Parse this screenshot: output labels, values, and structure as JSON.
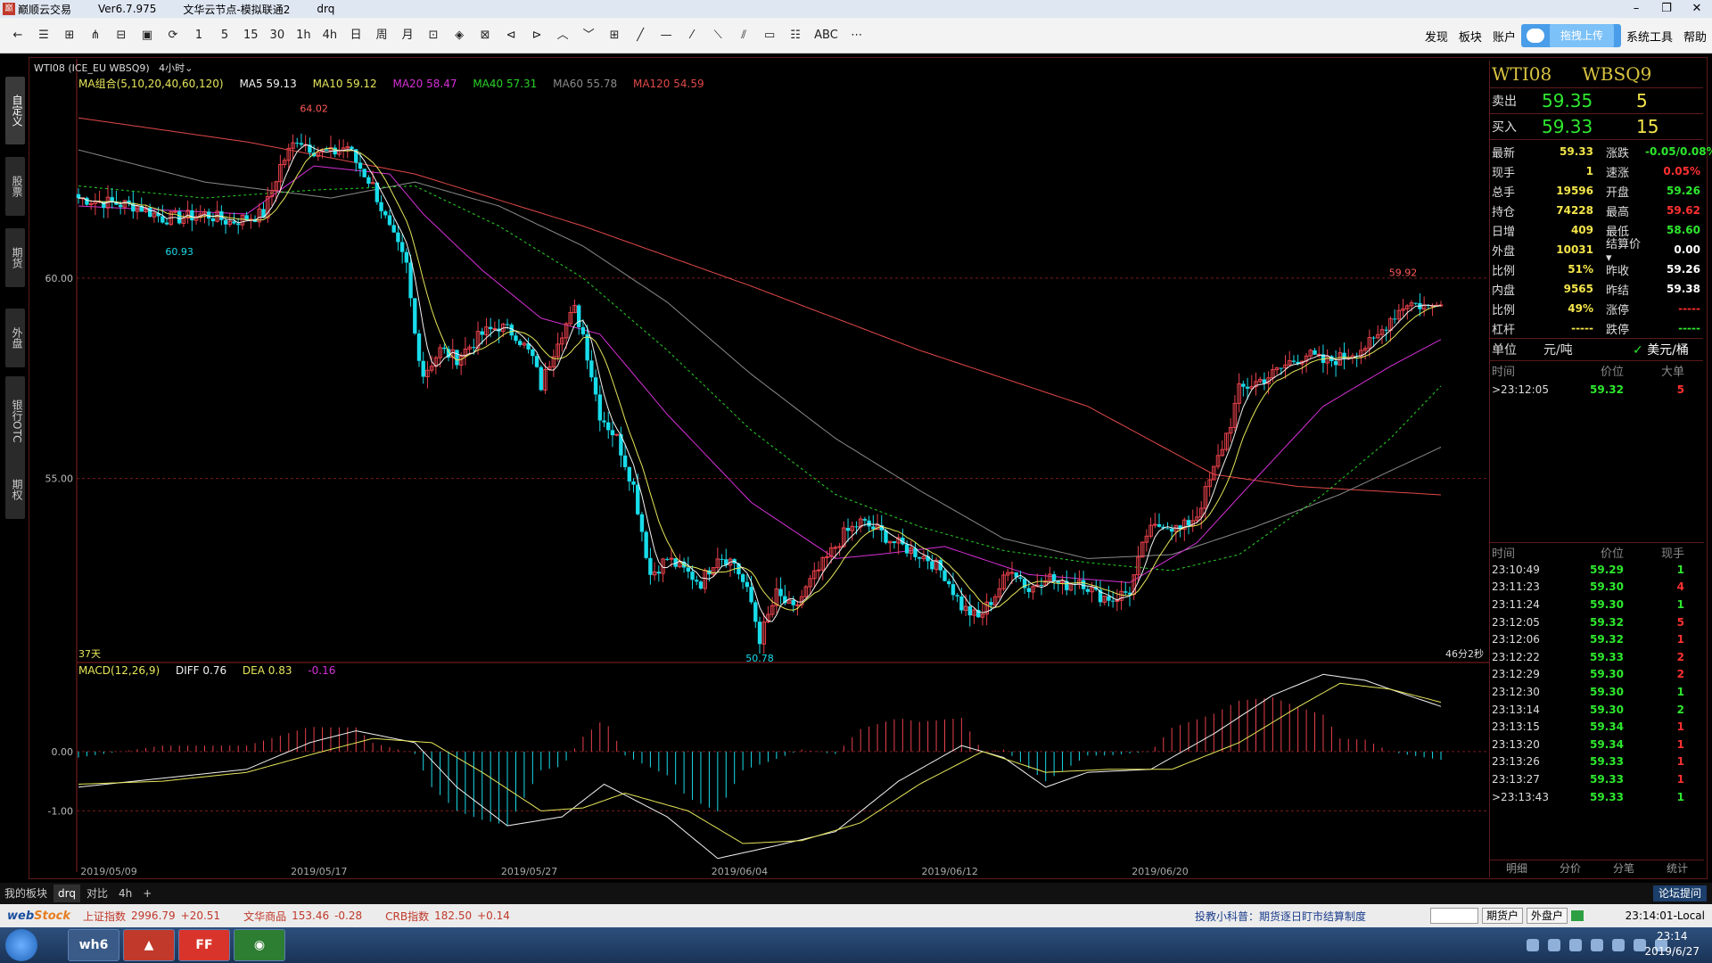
{
  "window": {
    "icon_text": "巅",
    "app_name": "巅顺云交易",
    "version": "Ver6.7.975",
    "node": "文华云节点-模拟联通2",
    "account": "drq",
    "min": "–",
    "restore": "❐",
    "close": "✕"
  },
  "toolbar": {
    "buttons": [
      "←",
      "☰",
      "⊞",
      "⋔",
      "⊟",
      "▣",
      "⟳",
      "1",
      "5",
      "15",
      "30",
      "1h",
      "4h",
      "日",
      "周",
      "月",
      "⊡",
      "◈",
      "⊠",
      "⊲",
      "⊳",
      "︿",
      "﹀",
      "⊞",
      "╱",
      "—",
      "⁄",
      "⟍",
      "⫽",
      "▭",
      "☷",
      "ABC",
      "⋯"
    ],
    "menu_discover": "发现",
    "menu_sector": "板块",
    "menu_account": "账户",
    "upload_label": "拖拽上传",
    "menu_tools": "系统工具",
    "menu_help": "帮助"
  },
  "left_tabs": [
    "自定义",
    "股票",
    "期货",
    "外盘",
    "银行OTC",
    "期权"
  ],
  "header": {
    "instrument": "WTI08  (ICE_EU WBSQ9)",
    "period": "4小时"
  },
  "ma_legend": {
    "group": "MA组合(5,10,20,40,60,120)",
    "ma5": "MA5 59.13",
    "ma10": "MA10 59.12",
    "ma20": "MA20 58.47",
    "ma40": "MA40 57.31",
    "ma60": "MA60 55.78",
    "ma120": "MA120 54.59"
  },
  "macd_legend": {
    "name": "MACD(12,26,9)",
    "diff": "DIFF 0.76",
    "dea": "DEA 0.83",
    "macd": "-0.16"
  },
  "colors": {
    "up": "#e8414b",
    "down": "#18dcea",
    "ma5": "#f2f2f2",
    "ma10": "#e6e65a",
    "ma20": "#d630d6",
    "ma40": "#28d228",
    "ma60": "#8a8a8a",
    "ma120": "#e04848",
    "diff": "#f2f2f2",
    "dea": "#e6e65a"
  },
  "chart_data": [
    {
      "type": "candlestick",
      "ylabel_ticks": [
        {
          "value": 60.0,
          "label": "60.00"
        },
        {
          "value": 55.0,
          "label": "55.00"
        }
      ],
      "ylim": [
        50.45,
        64.85
      ],
      "x_ticks": [
        "2019/05/09",
        "2019/05/17",
        "2019/05/27",
        "2019/06/04",
        "2019/06/12",
        "2019/06/20"
      ],
      "annotations": {
        "high": {
          "value": 64.02,
          "label": "64.02"
        },
        "low1": {
          "value": 60.93,
          "label": "60.93"
        },
        "low2": {
          "value": 50.78,
          "label": "50.78"
        },
        "recent_high": {
          "value": 59.92,
          "label": "59.92"
        },
        "days_label": "37天",
        "countdown": "46分2秒"
      },
      "anchors": [
        {
          "i": 0,
          "p": 62.0
        },
        {
          "i": 6,
          "p": 61.9
        },
        {
          "i": 14,
          "p": 61.8
        },
        {
          "i": 20,
          "p": 61.5
        },
        {
          "i": 24,
          "p": 61.5
        },
        {
          "i": 30,
          "p": 61.6
        },
        {
          "i": 36,
          "p": 61.4
        },
        {
          "i": 40,
          "p": 61.5
        },
        {
          "i": 44,
          "p": 61.6
        },
        {
          "i": 48,
          "p": 62.8
        },
        {
          "i": 52,
          "p": 63.5
        },
        {
          "i": 56,
          "p": 63.2
        },
        {
          "i": 60,
          "p": 63.1
        },
        {
          "i": 64,
          "p": 63.3
        },
        {
          "i": 66,
          "p": 62.9
        },
        {
          "i": 70,
          "p": 62.3
        },
        {
          "i": 74,
          "p": 61.2
        },
        {
          "i": 78,
          "p": 60.3
        },
        {
          "i": 80,
          "p": 58.6
        },
        {
          "i": 82,
          "p": 57.6
        },
        {
          "i": 86,
          "p": 58.2
        },
        {
          "i": 90,
          "p": 58.0
        },
        {
          "i": 96,
          "p": 58.6
        },
        {
          "i": 100,
          "p": 58.8
        },
        {
          "i": 104,
          "p": 58.6
        },
        {
          "i": 108,
          "p": 58.0
        },
        {
          "i": 110,
          "p": 57.3
        },
        {
          "i": 114,
          "p": 58.5
        },
        {
          "i": 118,
          "p": 59.2
        },
        {
          "i": 120,
          "p": 58.6
        },
        {
          "i": 124,
          "p": 56.6
        },
        {
          "i": 128,
          "p": 56.0
        },
        {
          "i": 132,
          "p": 54.8
        },
        {
          "i": 136,
          "p": 52.6
        },
        {
          "i": 140,
          "p": 53.0
        },
        {
          "i": 144,
          "p": 52.7
        },
        {
          "i": 148,
          "p": 52.4
        },
        {
          "i": 152,
          "p": 53.1
        },
        {
          "i": 156,
          "p": 52.9
        },
        {
          "i": 160,
          "p": 51.9
        },
        {
          "i": 162,
          "p": 51.0
        },
        {
          "i": 166,
          "p": 52.1
        },
        {
          "i": 170,
          "p": 51.7
        },
        {
          "i": 174,
          "p": 52.4
        },
        {
          "i": 178,
          "p": 53.0
        },
        {
          "i": 182,
          "p": 53.6
        },
        {
          "i": 186,
          "p": 53.9
        },
        {
          "i": 190,
          "p": 53.7
        },
        {
          "i": 194,
          "p": 53.4
        },
        {
          "i": 198,
          "p": 53.2
        },
        {
          "i": 202,
          "p": 53.0
        },
        {
          "i": 206,
          "p": 52.6
        },
        {
          "i": 210,
          "p": 51.8
        },
        {
          "i": 214,
          "p": 51.5
        },
        {
          "i": 218,
          "p": 52.1
        },
        {
          "i": 222,
          "p": 52.8
        },
        {
          "i": 226,
          "p": 52.2
        },
        {
          "i": 230,
          "p": 52.6
        },
        {
          "i": 234,
          "p": 52.3
        },
        {
          "i": 238,
          "p": 52.5
        },
        {
          "i": 242,
          "p": 52.1
        },
        {
          "i": 246,
          "p": 52.0
        },
        {
          "i": 250,
          "p": 52.2
        },
        {
          "i": 254,
          "p": 53.6
        },
        {
          "i": 258,
          "p": 53.9
        },
        {
          "i": 262,
          "p": 53.7
        },
        {
          "i": 266,
          "p": 54.1
        },
        {
          "i": 270,
          "p": 55.2
        },
        {
          "i": 274,
          "p": 56.4
        },
        {
          "i": 276,
          "p": 57.2
        },
        {
          "i": 280,
          "p": 57.4
        },
        {
          "i": 284,
          "p": 57.6
        },
        {
          "i": 288,
          "p": 57.9
        },
        {
          "i": 292,
          "p": 58.1
        },
        {
          "i": 296,
          "p": 57.9
        },
        {
          "i": 300,
          "p": 58.0
        },
        {
          "i": 304,
          "p": 58.2
        },
        {
          "i": 308,
          "p": 58.4
        },
        {
          "i": 312,
          "p": 59.0
        },
        {
          "i": 316,
          "p": 59.4
        },
        {
          "i": 320,
          "p": 59.3
        },
        {
          "i": 324,
          "p": 59.33
        }
      ],
      "ma_anchors": {
        "ma20": [
          {
            "i": 0,
            "p": 61.8
          },
          {
            "i": 40,
            "p": 61.6
          },
          {
            "i": 56,
            "p": 62.8
          },
          {
            "i": 74,
            "p": 62.6
          },
          {
            "i": 82,
            "p": 61.6
          },
          {
            "i": 96,
            "p": 60.2
          },
          {
            "i": 110,
            "p": 59.0
          },
          {
            "i": 124,
            "p": 58.6
          },
          {
            "i": 140,
            "p": 56.6
          },
          {
            "i": 160,
            "p": 54.4
          },
          {
            "i": 180,
            "p": 53.0
          },
          {
            "i": 190,
            "p": 53.1
          },
          {
            "i": 206,
            "p": 53.3
          },
          {
            "i": 226,
            "p": 52.6
          },
          {
            "i": 250,
            "p": 52.4
          },
          {
            "i": 266,
            "p": 53.4
          },
          {
            "i": 280,
            "p": 55.0
          },
          {
            "i": 296,
            "p": 56.8
          },
          {
            "i": 312,
            "p": 57.8
          },
          {
            "i": 324,
            "p": 58.47
          }
        ],
        "ma40": [
          {
            "i": 0,
            "p": 62.3
          },
          {
            "i": 30,
            "p": 62.0
          },
          {
            "i": 56,
            "p": 62.2
          },
          {
            "i": 80,
            "p": 62.3
          },
          {
            "i": 100,
            "p": 61.3
          },
          {
            "i": 120,
            "p": 60.0
          },
          {
            "i": 140,
            "p": 58.2
          },
          {
            "i": 160,
            "p": 56.2
          },
          {
            "i": 180,
            "p": 54.6
          },
          {
            "i": 200,
            "p": 53.8
          },
          {
            "i": 220,
            "p": 53.2
          },
          {
            "i": 240,
            "p": 52.9
          },
          {
            "i": 260,
            "p": 52.7
          },
          {
            "i": 276,
            "p": 53.1
          },
          {
            "i": 296,
            "p": 54.6
          },
          {
            "i": 312,
            "p": 56.0
          },
          {
            "i": 324,
            "p": 57.31
          }
        ],
        "ma60": [
          {
            "i": 0,
            "p": 63.2
          },
          {
            "i": 30,
            "p": 62.4
          },
          {
            "i": 60,
            "p": 62.0
          },
          {
            "i": 80,
            "p": 62.4
          },
          {
            "i": 100,
            "p": 61.8
          },
          {
            "i": 120,
            "p": 60.8
          },
          {
            "i": 140,
            "p": 59.4
          },
          {
            "i": 160,
            "p": 57.6
          },
          {
            "i": 180,
            "p": 56.0
          },
          {
            "i": 200,
            "p": 54.7
          },
          {
            "i": 220,
            "p": 53.5
          },
          {
            "i": 240,
            "p": 53.0
          },
          {
            "i": 260,
            "p": 53.1
          },
          {
            "i": 280,
            "p": 53.8
          },
          {
            "i": 300,
            "p": 54.6
          },
          {
            "i": 324,
            "p": 55.78
          }
        ],
        "ma120": [
          {
            "i": 0,
            "p": 64.0
          },
          {
            "i": 40,
            "p": 63.4
          },
          {
            "i": 80,
            "p": 62.6
          },
          {
            "i": 120,
            "p": 61.3
          },
          {
            "i": 160,
            "p": 59.8
          },
          {
            "i": 200,
            "p": 58.2
          },
          {
            "i": 240,
            "p": 56.8
          },
          {
            "i": 270,
            "p": 55.1
          },
          {
            "i": 290,
            "p": 54.8
          },
          {
            "i": 324,
            "p": 54.59
          }
        ]
      }
    },
    {
      "type": "macd",
      "ylabel_ticks": [
        {
          "value": 0.0,
          "label": "0.00"
        },
        {
          "value": -1.0,
          "label": "-1.00"
        }
      ],
      "ylim": [
        -1.88,
        1.47
      ],
      "diff_anchors": [
        {
          "i": 0,
          "v": -0.6
        },
        {
          "i": 20,
          "v": -0.45
        },
        {
          "i": 40,
          "v": -0.3
        },
        {
          "i": 55,
          "v": 0.15
        },
        {
          "i": 66,
          "v": 0.35
        },
        {
          "i": 80,
          "v": 0.15
        },
        {
          "i": 90,
          "v": -0.6
        },
        {
          "i": 102,
          "v": -1.25
        },
        {
          "i": 115,
          "v": -1.1
        },
        {
          "i": 125,
          "v": -0.55
        },
        {
          "i": 140,
          "v": -1.1
        },
        {
          "i": 152,
          "v": -1.8
        },
        {
          "i": 165,
          "v": -1.6
        },
        {
          "i": 180,
          "v": -1.35
        },
        {
          "i": 195,
          "v": -0.5
        },
        {
          "i": 210,
          "v": 0.1
        },
        {
          "i": 220,
          "v": -0.1
        },
        {
          "i": 230,
          "v": -0.6
        },
        {
          "i": 240,
          "v": -0.35
        },
        {
          "i": 255,
          "v": -0.3
        },
        {
          "i": 270,
          "v": 0.3
        },
        {
          "i": 284,
          "v": 0.95
        },
        {
          "i": 296,
          "v": 1.3
        },
        {
          "i": 306,
          "v": 1.2
        },
        {
          "i": 316,
          "v": 0.95
        },
        {
          "i": 324,
          "v": 0.76
        }
      ],
      "dea_anchors": [
        {
          "i": 0,
          "v": -0.55
        },
        {
          "i": 20,
          "v": -0.5
        },
        {
          "i": 40,
          "v": -0.35
        },
        {
          "i": 58,
          "v": 0.0
        },
        {
          "i": 70,
          "v": 0.22
        },
        {
          "i": 84,
          "v": 0.15
        },
        {
          "i": 96,
          "v": -0.35
        },
        {
          "i": 110,
          "v": -1.0
        },
        {
          "i": 120,
          "v": -0.95
        },
        {
          "i": 130,
          "v": -0.7
        },
        {
          "i": 145,
          "v": -1.0
        },
        {
          "i": 158,
          "v": -1.55
        },
        {
          "i": 172,
          "v": -1.5
        },
        {
          "i": 186,
          "v": -1.2
        },
        {
          "i": 200,
          "v": -0.55
        },
        {
          "i": 215,
          "v": 0.0
        },
        {
          "i": 230,
          "v": -0.35
        },
        {
          "i": 245,
          "v": -0.3
        },
        {
          "i": 260,
          "v": -0.3
        },
        {
          "i": 276,
          "v": 0.15
        },
        {
          "i": 290,
          "v": 0.75
        },
        {
          "i": 300,
          "v": 1.15
        },
        {
          "i": 312,
          "v": 1.05
        },
        {
          "i": 324,
          "v": 0.83
        }
      ]
    }
  ],
  "right_panel": {
    "symbol": "WTI08",
    "code": "WBSQ9",
    "ask_label": "卖出",
    "ask_price": "59.35",
    "ask_vol": "5",
    "bid_label": "买入",
    "bid_price": "59.33",
    "bid_vol": "15",
    "stats": [
      {
        "k1": "最新",
        "v1": "59.33",
        "c1": "#f4e54a",
        "k2": "涨跌",
        "v2": "-0.05/0.08%",
        "c2": "#2ee82e"
      },
      {
        "k1": "现手",
        "v1": "1",
        "c1": "#f4e54a",
        "k2": "速涨",
        "v2": "0.05%",
        "c2": "#ff3030"
      },
      {
        "k1": "总手",
        "v1": "19596",
        "c1": "#f4e54a",
        "k2": "开盘",
        "v2": "59.26",
        "c2": "#2ee82e"
      },
      {
        "k1": "持仓",
        "v1": "74228",
        "c1": "#f4e54a",
        "k2": "最高",
        "v2": "59.62",
        "c2": "#ff3030"
      },
      {
        "k1": "日增",
        "v1": "409",
        "c1": "#f4e54a",
        "k2": "最低",
        "v2": "58.60",
        "c2": "#2ee82e"
      },
      {
        "k1": "外盘",
        "v1": "10031",
        "c1": "#f4e54a",
        "k2": "结算价 ▾",
        "v2": "0.00",
        "c2": "#ffffff"
      },
      {
        "k1": "比例",
        "v1": "51%",
        "c1": "#f4e54a",
        "k2": "昨收",
        "v2": "59.26",
        "c2": "#ffffff"
      },
      {
        "k1": "内盘",
        "v1": "9565",
        "c1": "#f4e54a",
        "k2": "昨结",
        "v2": "59.38",
        "c2": "#ffffff"
      },
      {
        "k1": "比例",
        "v1": "49%",
        "c1": "#f4e54a",
        "k2": "涨停",
        "v2": "-----",
        "c2": "#ff3030"
      },
      {
        "k1": "杠杆",
        "v1": "-----",
        "c1": "#f4e54a",
        "k2": "跌停",
        "v2": "-----",
        "c2": "#2ee82e"
      }
    ],
    "unit_label": "单位",
    "unit_cny": "元/吨",
    "unit_check": "✓",
    "unit_usd": "美元/桶",
    "big_header": {
      "time": "时间",
      "price": "价位",
      "big": "大单"
    },
    "big_rows": [
      {
        "time": ">23:12:05",
        "price": "59.32",
        "vol": "5",
        "color": "#ff3030"
      }
    ],
    "tick_header": {
      "time": "时间",
      "price": "价位",
      "vol": "现手"
    },
    "ticks": [
      {
        "time": "23:10:49",
        "price": "59.29",
        "vol": "1",
        "color": "#2ee82e"
      },
      {
        "time": "23:11:23",
        "price": "59.30",
        "vol": "4",
        "color": "#ff3030"
      },
      {
        "time": "23:11:24",
        "price": "59.30",
        "vol": "1",
        "color": "#2ee82e"
      },
      {
        "time": "23:12:05",
        "price": "59.32",
        "vol": "5",
        "color": "#ff3030"
      },
      {
        "time": "23:12:06",
        "price": "59.32",
        "vol": "1",
        "color": "#ff3030"
      },
      {
        "time": "23:12:22",
        "price": "59.33",
        "vol": "2",
        "color": "#ff3030"
      },
      {
        "time": "23:12:29",
        "price": "59.30",
        "vol": "2",
        "color": "#ff3030"
      },
      {
        "time": "23:12:30",
        "price": "59.30",
        "vol": "1",
        "color": "#2ee82e"
      },
      {
        "time": "23:13:14",
        "price": "59.30",
        "vol": "2",
        "color": "#2ee82e"
      },
      {
        "time": "23:13:15",
        "price": "59.34",
        "vol": "1",
        "color": "#ff3030"
      },
      {
        "time": "23:13:20",
        "price": "59.34",
        "vol": "1",
        "color": "#ff3030"
      },
      {
        "time": "23:13:26",
        "price": "59.33",
        "vol": "1",
        "color": "#ff3030"
      },
      {
        "time": "23:13:27",
        "price": "59.33",
        "vol": "1",
        "color": "#ff3030"
      },
      {
        "time": ">23:13:43",
        "price": "59.33",
        "vol": "1",
        "color": "#2ee82e"
      }
    ],
    "tabs": [
      "明细",
      "分价",
      "分笔",
      "统计"
    ]
  },
  "bottom_tabs": {
    "items": [
      "我的板块",
      "drq",
      "对比",
      "4h",
      "+"
    ],
    "forum": "论坛提问"
  },
  "index_bar": {
    "logo_web": "web",
    "logo_stock": "Stock",
    "items": [
      {
        "name": "上证指数",
        "value": "2996.79",
        "delta": "+20.51"
      },
      {
        "name": "文华商品",
        "value": "153.46",
        "delta": "-0.28"
      },
      {
        "name": "CRB指数",
        "value": "182.50",
        "delta": "+0.14"
      }
    ],
    "news": "投教小科普：期货逐日盯市结算制度",
    "btn_futures": "期货户",
    "btn_foreign": "外盘户",
    "clock": "23:14:01-Local"
  },
  "taskbar": {
    "apps": [
      "wh6",
      "▲",
      "FF",
      "◉"
    ],
    "time": "23:14",
    "date": "2019/6/27"
  }
}
